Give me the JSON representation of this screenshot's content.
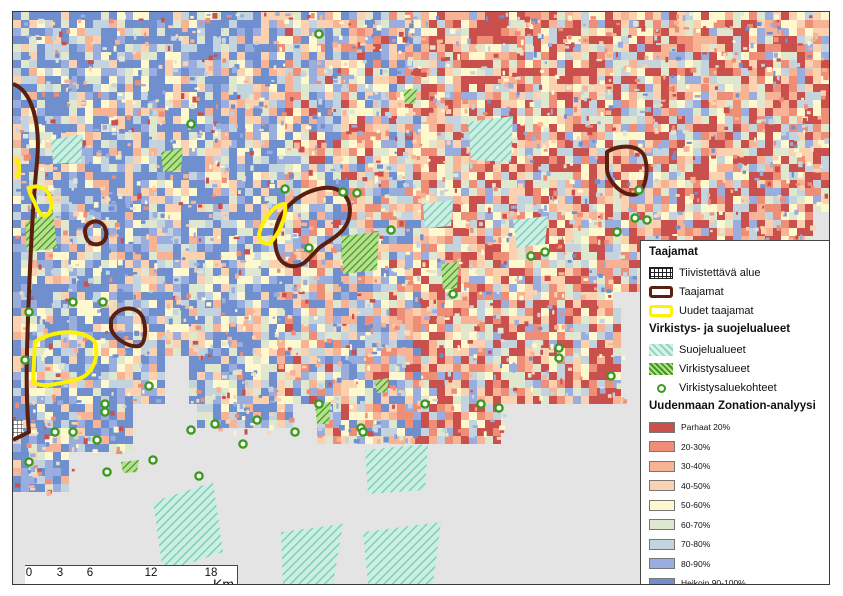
{
  "map": {
    "colors": {
      "water": "#e4e4e4",
      "taajamat": "#5a1f0e",
      "uudet": "#fff200",
      "green": "#3b9a1b",
      "suojelu": "#9fdcc9"
    }
  },
  "legend": {
    "group1_title": "Taajamat",
    "group1_items": [
      {
        "label": "Tiivistettävä alue",
        "icon": "grid-hatch-swatch"
      },
      {
        "label": "Taajamat",
        "icon": "brown-outline-swatch"
      },
      {
        "label": "Uudet taajamat",
        "icon": "yellow-outline-swatch"
      }
    ],
    "group2_title": "Virkistys- ja suojelualueet",
    "group2_items": [
      {
        "label": "Suojelualueet",
        "icon": "cyan-hatch-swatch"
      },
      {
        "label": "Virkistysalueet",
        "icon": "green-hatch-swatch"
      },
      {
        "label": "Virkistysaluekohteet",
        "icon": "green-ring-marker"
      }
    ],
    "group3_title": "Uudenmaan Zonation-analyysi",
    "zonation": [
      {
        "label": "Parhaat 20%",
        "color": "#c9504c"
      },
      {
        "label": "20-30%",
        "color": "#ee8e77"
      },
      {
        "label": "30-40%",
        "color": "#f7b394"
      },
      {
        "label": "40-50%",
        "color": "#fcd1b0"
      },
      {
        "label": "50-60%",
        "color": "#fdf8cd"
      },
      {
        "label": "60-70%",
        "color": "#dfe7cf"
      },
      {
        "label": "70-80%",
        "color": "#c3d4de"
      },
      {
        "label": "80-90%",
        "color": "#99addf"
      },
      {
        "label": "Heikoin 90-100%",
        "color": "#6f8fcf"
      }
    ]
  },
  "scalebar": {
    "ticks": [
      "0",
      "3",
      "6",
      "12",
      "18"
    ],
    "unit": "Km"
  }
}
